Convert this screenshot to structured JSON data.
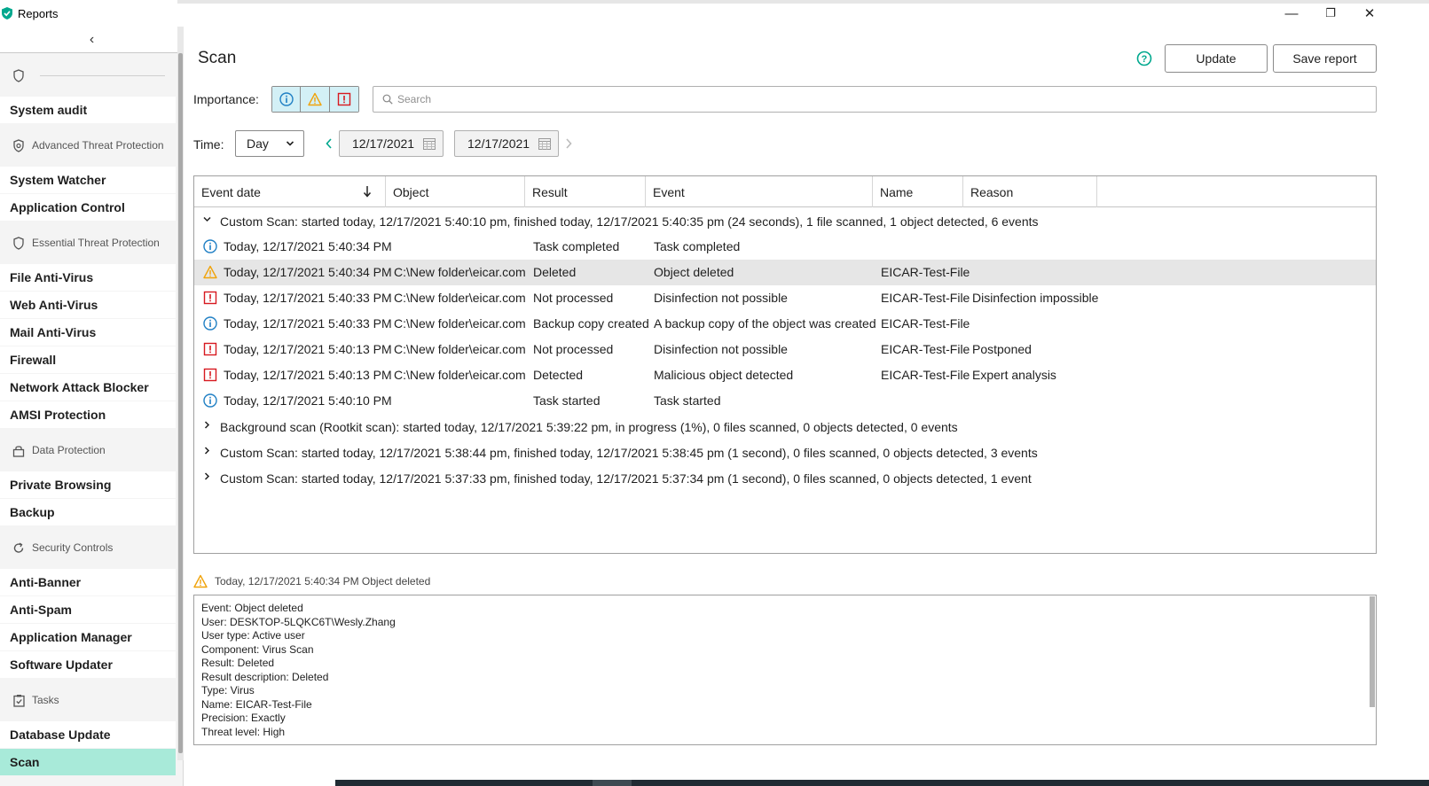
{
  "window": {
    "title": "Reports",
    "minimize": "—",
    "restore": "❐",
    "close": "✕"
  },
  "sidebar": {
    "collapse": "‹",
    "sections": [
      {
        "type": "group",
        "label": "",
        "icon": "shield-icon"
      },
      {
        "type": "item",
        "label": "System audit"
      },
      {
        "type": "group",
        "label": "Advanced Threat Protection",
        "icon": "shield-gear-icon"
      },
      {
        "type": "item",
        "label": "System Watcher"
      },
      {
        "type": "item",
        "label": "Application Control"
      },
      {
        "type": "group",
        "label": "Essential Threat Protection",
        "icon": "shield-icon"
      },
      {
        "type": "item",
        "label": "File Anti-Virus"
      },
      {
        "type": "item",
        "label": "Web Anti-Virus"
      },
      {
        "type": "item",
        "label": "Mail Anti-Virus"
      },
      {
        "type": "item",
        "label": "Firewall"
      },
      {
        "type": "item",
        "label": "Network Attack Blocker"
      },
      {
        "type": "item",
        "label": "AMSI Protection"
      },
      {
        "type": "group",
        "label": "Data Protection",
        "icon": "lock-icon"
      },
      {
        "type": "item",
        "label": "Private Browsing"
      },
      {
        "type": "item",
        "label": "Backup"
      },
      {
        "type": "group",
        "label": "Security Controls",
        "icon": "refresh-shield-icon"
      },
      {
        "type": "item",
        "label": "Anti-Banner"
      },
      {
        "type": "item",
        "label": "Anti-Spam"
      },
      {
        "type": "item",
        "label": "Application Manager"
      },
      {
        "type": "item",
        "label": "Software Updater"
      },
      {
        "type": "group",
        "label": "Tasks",
        "icon": "clipboard-check-icon"
      },
      {
        "type": "item",
        "label": "Database Update"
      },
      {
        "type": "item",
        "label": "Scan",
        "active": true
      }
    ]
  },
  "main": {
    "title": "Scan",
    "update_label": "Update",
    "save_report_label": "Save report",
    "importance_label": "Importance:",
    "search_placeholder": "Search",
    "time_label": "Time:",
    "period": "Day",
    "date_from": "12/17/2021",
    "date_to": "12/17/2021"
  },
  "table": {
    "columns": [
      "Event date",
      "Object",
      "Result",
      "Event",
      "Name",
      "Reason"
    ],
    "groups": [
      {
        "label": "Custom Scan: started today, 12/17/2021 5:40:10 pm, finished today, 12/17/2021 5:40:35 pm (24 seconds), 1 file scanned, 1 object detected, 6 events",
        "expanded": true,
        "rows": [
          {
            "level": "info",
            "date": "Today, 12/17/2021 5:40:34 PM",
            "object": "",
            "result": "Task completed",
            "event": "Task completed",
            "name": "",
            "reason": ""
          },
          {
            "level": "warning",
            "date": "Today, 12/17/2021 5:40:34 PM",
            "object": "C:\\New folder\\eicar.com",
            "result": "Deleted",
            "event": "Object deleted",
            "name": "EICAR-Test-File",
            "reason": "",
            "selected": true
          },
          {
            "level": "critical",
            "date": "Today, 12/17/2021 5:40:33 PM",
            "object": "C:\\New folder\\eicar.com",
            "result": "Not processed",
            "event": "Disinfection not possible",
            "name": "EICAR-Test-File",
            "reason": "Disinfection impossible"
          },
          {
            "level": "info",
            "date": "Today, 12/17/2021 5:40:33 PM",
            "object": "C:\\New folder\\eicar.com",
            "result": "Backup copy created",
            "event": "A backup copy of the object was created",
            "name": "EICAR-Test-File",
            "reason": ""
          },
          {
            "level": "critical",
            "date": "Today, 12/17/2021 5:40:13 PM",
            "object": "C:\\New folder\\eicar.com",
            "result": "Not processed",
            "event": "Disinfection not possible",
            "name": "EICAR-Test-File",
            "reason": "Postponed"
          },
          {
            "level": "critical",
            "date": "Today, 12/17/2021 5:40:13 PM",
            "object": "C:\\New folder\\eicar.com",
            "result": "Detected",
            "event": "Malicious object detected",
            "name": "EICAR-Test-File",
            "reason": "Expert analysis"
          },
          {
            "level": "info",
            "date": "Today, 12/17/2021 5:40:10 PM",
            "object": "",
            "result": "Task started",
            "event": "Task started",
            "name": "",
            "reason": ""
          }
        ]
      },
      {
        "label": "Background scan (Rootkit scan): started today, 12/17/2021 5:39:22 pm, in progress (1%), 0 files scanned, 0 objects detected, 0 events",
        "expanded": false,
        "rows": []
      },
      {
        "label": "Custom Scan: started today, 12/17/2021 5:38:44 pm, finished today, 12/17/2021 5:38:45 pm (1 second), 0 files scanned, 0 objects detected, 3 events",
        "expanded": false,
        "rows": []
      },
      {
        "label": "Custom Scan: started today, 12/17/2021 5:37:33 pm, finished today, 12/17/2021 5:37:34 pm (1 second), 0 files scanned, 0 objects detected, 1 event",
        "expanded": false,
        "rows": []
      }
    ]
  },
  "details": {
    "header": "Today, 12/17/2021 5:40:34 PM Object deleted",
    "lines": [
      "Event: Object deleted",
      "User: DESKTOP-5LQKC6T\\Wesly.Zhang",
      "User type: Active user",
      "Component: Virus Scan",
      "Result: Deleted",
      "Result description: Deleted",
      "Type: Virus",
      "Name: EICAR-Test-File",
      "Precision: Exactly",
      "Threat level: High"
    ]
  },
  "colors": {
    "accent": "#00a88e",
    "info": "#1f7fc4",
    "warning": "#f0a30a",
    "critical": "#d71920",
    "active_item": "#a8ead9"
  }
}
